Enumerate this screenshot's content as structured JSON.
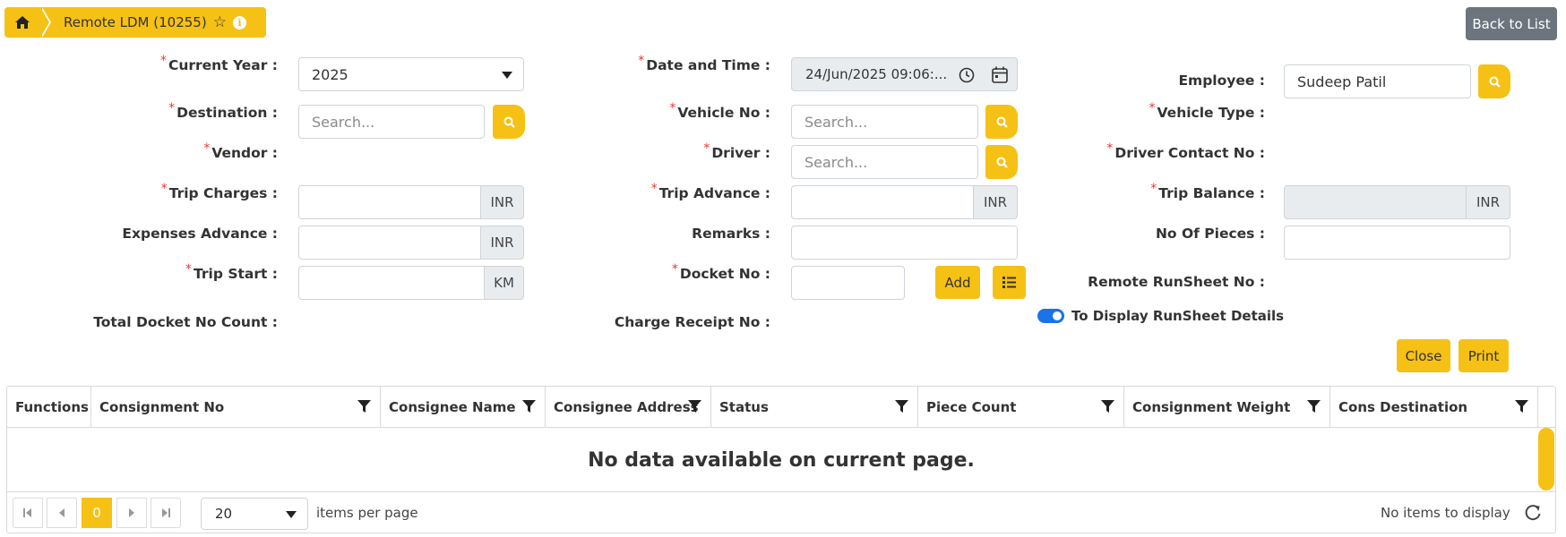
{
  "breadcrumb": {
    "title": "Remote LDM (10255)"
  },
  "header": {
    "back_label": "Back to List"
  },
  "form": {
    "current_year": {
      "label": "Current Year :",
      "value": "2025"
    },
    "date_time": {
      "label": "Date and Time :",
      "value": "24/Jun/2025 09:06:..."
    },
    "employee": {
      "label": "Employee :",
      "value": "Sudeep Patil"
    },
    "destination": {
      "label": "Destination :",
      "placeholder": "Search..."
    },
    "vehicle_no": {
      "label": "Vehicle No :",
      "placeholder": "Search..."
    },
    "vehicle_type": {
      "label": "Vehicle Type :"
    },
    "vendor": {
      "label": "Vendor :"
    },
    "driver": {
      "label": "Driver :",
      "placeholder": "Search..."
    },
    "driver_contact": {
      "label": "Driver Contact No :"
    },
    "trip_charges": {
      "label": "Trip Charges :",
      "unit": "INR"
    },
    "trip_advance": {
      "label": "Trip Advance :",
      "unit": "INR"
    },
    "trip_balance": {
      "label": "Trip Balance :",
      "unit": "INR"
    },
    "expenses_advance": {
      "label": "Expenses Advance :",
      "unit": "INR"
    },
    "remarks": {
      "label": "Remarks :"
    },
    "no_of_pieces": {
      "label": "No Of Pieces :"
    },
    "trip_start": {
      "label": "Trip Start :",
      "unit": "KM"
    },
    "docket_no": {
      "label": "Docket No :",
      "add_label": "Add"
    },
    "remote_runsheet": {
      "label": "Remote RunSheet No :"
    },
    "total_docket": {
      "label": "Total Docket No Count :"
    },
    "charge_receipt": {
      "label": "Charge Receipt No :"
    },
    "runsheet_toggle": {
      "label": "To Display RunSheet Details",
      "on": true
    }
  },
  "actions": {
    "close_label": "Close",
    "print_label": "Print"
  },
  "grid": {
    "columns": [
      "Functions",
      "Consignment No",
      "Consignee Name",
      "Consignee Address",
      "Status",
      "Piece Count",
      "Consignment Weight",
      "Cons Destination"
    ],
    "empty_message": "No data available on current page.",
    "pager": {
      "current_page": "0",
      "page_size": "20",
      "page_size_label": "items per page",
      "status": "No items to display"
    }
  },
  "colors": {
    "accent": "#f6c115",
    "secondary": "#6c757d",
    "required": "#e53935",
    "toggle": "#1a73e8"
  }
}
